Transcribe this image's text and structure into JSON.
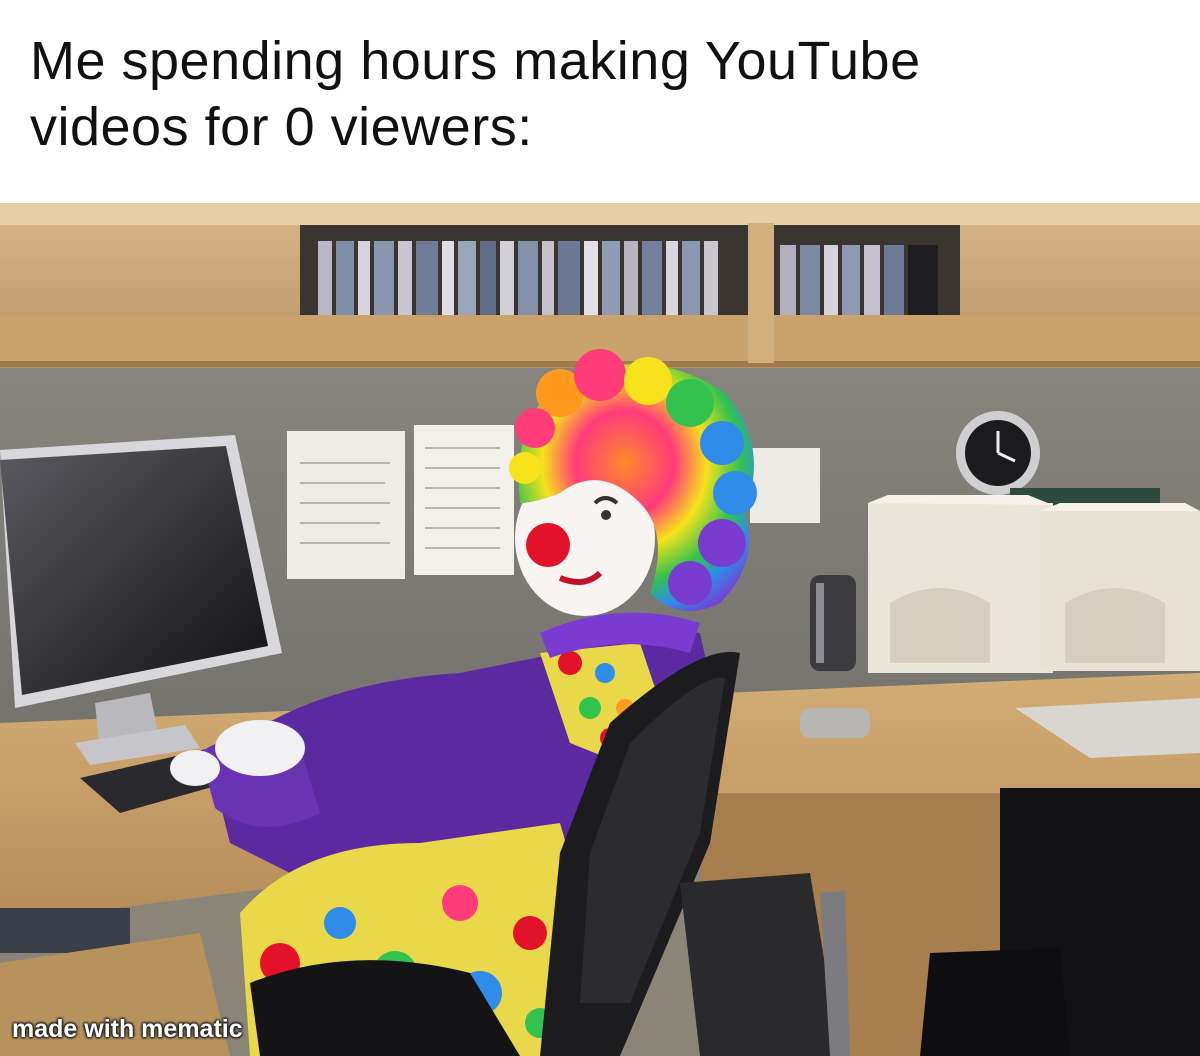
{
  "caption": {
    "text": "Me spending hours making YouTube\nvideos for 0 viewers:"
  },
  "photo": {
    "subject": "clown-at-office-desk",
    "colors": {
      "shelf_wood": "#c9a36b",
      "wall_gray": "#7e7c76",
      "desk_wood": "#c79e68",
      "clown_costume_purple": "#5b2aa0",
      "clown_wig_rainbow": [
        "#ff3b7a",
        "#ff9a1f",
        "#f7e21b",
        "#33c24d",
        "#2f8ce8",
        "#7a3bd1"
      ],
      "clown_nose_red": "#e3122a",
      "chair_black": "#1c1c1f"
    }
  },
  "watermark": {
    "text": "made with mematic"
  }
}
